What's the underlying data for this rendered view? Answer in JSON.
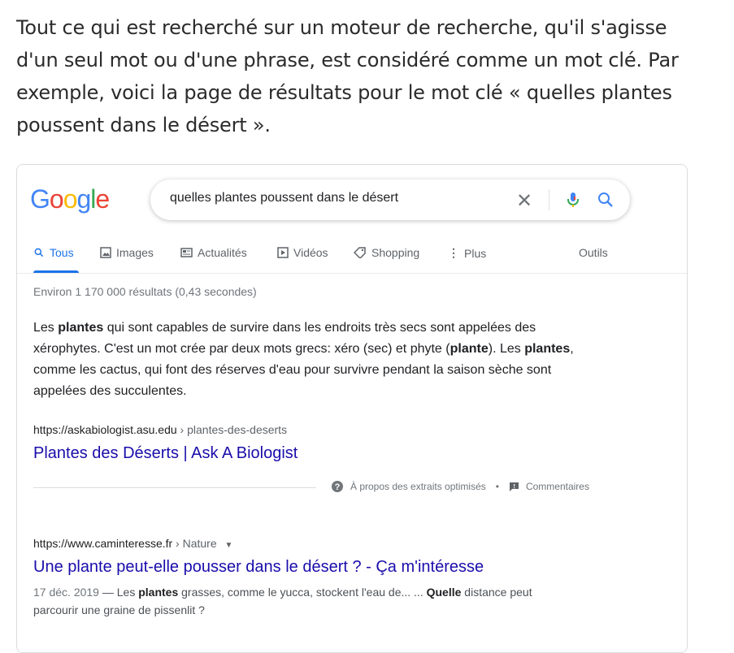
{
  "intro": "Tout ce qui est recherché sur un moteur de recherche, qu'il s'agisse d'un seul mot ou d'une phrase, est considéré comme un mot clé. Par exemple, voici la page de résultats pour le mot clé « quelles plantes poussent dans le désert ».",
  "google": {
    "logo": "Google",
    "search_query": "quelles plantes poussent dans le désert",
    "tabs": [
      {
        "label": "Tous",
        "icon": "search-icon"
      },
      {
        "label": "Images",
        "icon": "image-icon"
      },
      {
        "label": "Actualités",
        "icon": "news-icon"
      },
      {
        "label": "Vidéos",
        "icon": "video-icon"
      },
      {
        "label": "Shopping",
        "icon": "tag-icon"
      },
      {
        "label": "Plus",
        "icon": "more-vert-icon"
      }
    ],
    "tools_label": "Outils",
    "stats": "Environ 1 170 000 résultats (0,43 secondes)",
    "featured": {
      "snippet_parts": [
        "Les ",
        "plantes",
        " qui sont capables de survire dans les endroits très secs sont appelées des xérophytes. C'est un mot crée par deux mots grecs: xéro (sec) et phyte (",
        "plante",
        "). Les ",
        "plantes",
        ", comme les cactus, qui font des réserves d'eau pour survivre pendant la saison sèche sont appelées des succulentes."
      ],
      "cite_domain": "https://askabiologist.asu.edu",
      "cite_path": " › plantes-des-deserts",
      "title": "Plantes des Déserts | Ask A Biologist",
      "about_label": "À propos des extraits optimisés",
      "feedback_label": "Commentaires"
    },
    "result2": {
      "cite_domain": "https://www.caminteresse.fr",
      "cite_path": " › Nature",
      "title": "Une plante peut-elle pousser dans le désert ? - Ça m'intéresse",
      "date": "17 déc. 2019",
      "desc_parts": [
        " — Les ",
        "plantes",
        " grasses, comme le yucca, stockent l'eau de... ... ",
        "Quelle",
        " distance peut parcourir une graine de pissenlit ?"
      ]
    }
  },
  "colors": {
    "accent": "#1a73e8",
    "link": "#1a0dab"
  }
}
